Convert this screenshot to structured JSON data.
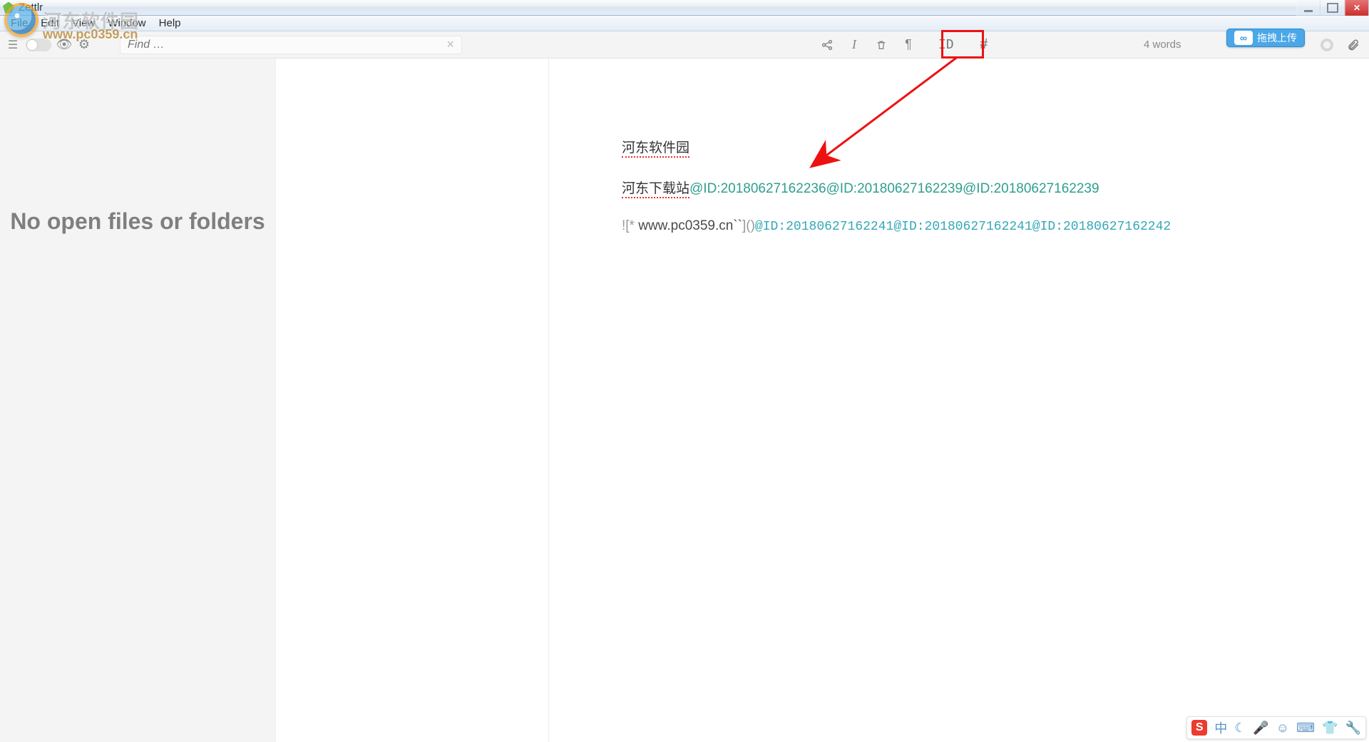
{
  "window": {
    "title": "Zettlr"
  },
  "menubar": {
    "items": [
      "File",
      "Edit",
      "View",
      "Window",
      "Help"
    ]
  },
  "toolbar": {
    "search_placeholder": "Find …",
    "icons": {
      "share": "share-icon",
      "info": "info-icon",
      "trash": "trash-icon",
      "pilcrow": "pilcrow-icon",
      "id": "ID",
      "hash": "#"
    },
    "word_count": "4 words",
    "upload_pill": "拖拽上传"
  },
  "watermark": {
    "text": "河东软件园",
    "url": "www.pc0359.cn"
  },
  "sidebar": {
    "empty_text": "No open files or folders"
  },
  "editor": {
    "line1": {
      "text": "河东软件园"
    },
    "line2": {
      "prefix": "河东下载站",
      "refs": "@ID:20180627162236@ID:20180627162239@ID:20180627162239"
    },
    "line3": {
      "md_prefix": "![* ",
      "url": "www.pc0359.cn``",
      "md_suffix": "]()",
      "ids": "@ID:20180627162241@ID:20180627162241@ID:20180627162242"
    }
  },
  "ime": {
    "badge": "S",
    "items": [
      "中",
      "☾",
      "🎤",
      "☺",
      "⌨",
      "👕",
      "🔧"
    ]
  }
}
